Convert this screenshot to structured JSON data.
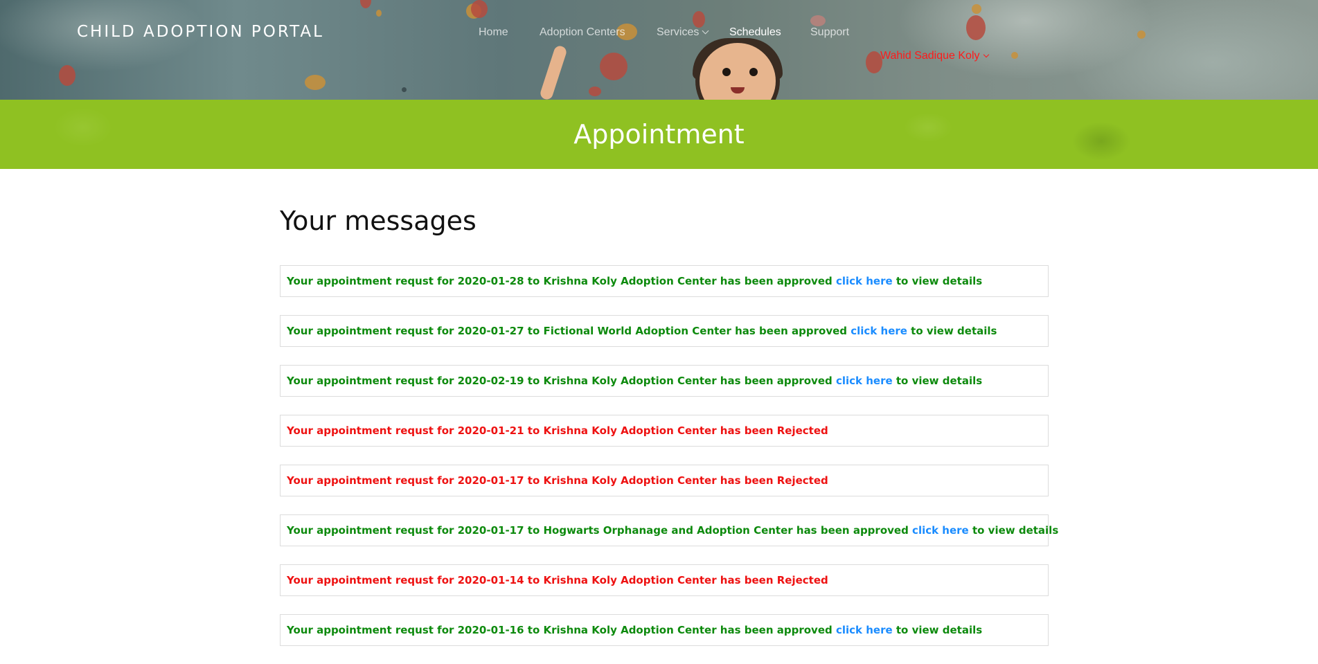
{
  "header": {
    "brand": "CHILD ADOPTION PORTAL",
    "nav": [
      {
        "label": "Home"
      },
      {
        "label": "Adoption Centers"
      },
      {
        "label": "Services"
      },
      {
        "label": "Schedules"
      },
      {
        "label": "Support"
      }
    ],
    "user": "Wahid Sadique Koly"
  },
  "band": {
    "title": "Appointment"
  },
  "messages_section": {
    "title": "Your messages",
    "items": [
      {
        "text": "Your appointment requst for 2020-01-28 to Krishna Koly Adoption Center has been approved",
        "link": "click here",
        "suffix": "to view details",
        "status": "approved"
      },
      {
        "text": "Your appointment requst for 2020-01-27 to Fictional World Adoption Center has been approved",
        "link": "click here",
        "suffix": "to view details",
        "status": "approved"
      },
      {
        "text": "Your appointment requst for 2020-02-19 to Krishna Koly Adoption Center has been approved",
        "link": "click here",
        "suffix": "to view details",
        "status": "approved"
      },
      {
        "text": "Your appointment requst for 2020-01-21 to Krishna Koly Adoption Center has been Rejected",
        "status": "rejected"
      },
      {
        "text": "Your appointment requst for 2020-01-17 to Krishna Koly Adoption Center has been Rejected",
        "status": "rejected"
      },
      {
        "text": "Your appointment requst for 2020-01-17 to Hogwarts Orphanage and Adoption Center has been approved",
        "link": "click here",
        "suffix": "to view details",
        "status": "approved"
      },
      {
        "text": "Your appointment requst for 2020-01-14 to Krishna Koly Adoption Center has been Rejected",
        "status": "rejected"
      },
      {
        "text": "Your appointment requst for 2020-01-16 to Krishna Koly Adoption Center has been approved",
        "link": "click here",
        "suffix": "to view details",
        "status": "approved"
      }
    ]
  },
  "colors": {
    "band_green": "#8fc122",
    "approved_text": "#0d8a0d",
    "rejected_text": "#ee1111",
    "link": "#1a8cff",
    "user_menu": "#ff1a1a"
  }
}
